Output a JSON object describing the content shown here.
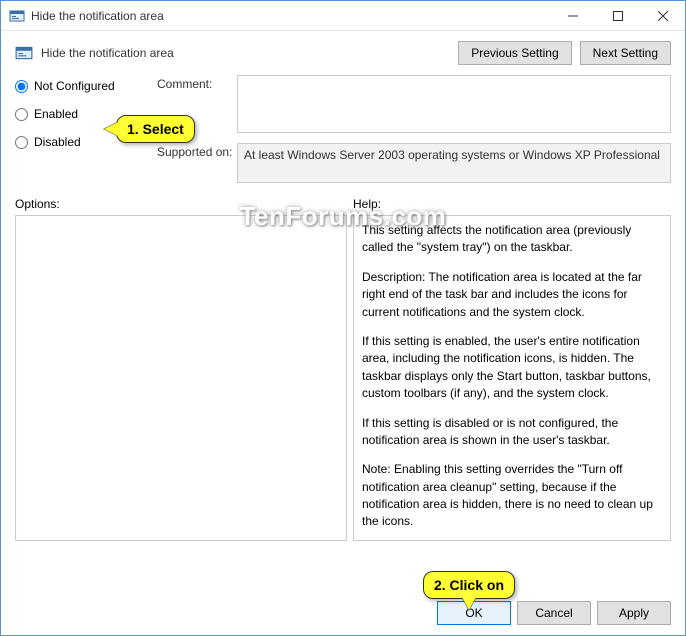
{
  "titlebar": {
    "title": "Hide the notification area"
  },
  "header": {
    "setting_title": "Hide the notification area",
    "prev": "Previous Setting",
    "next": "Next Setting"
  },
  "radios": {
    "not_configured": "Not Configured",
    "enabled": "Enabled",
    "disabled": "Disabled"
  },
  "fields": {
    "comment_label": "Comment:",
    "comment_value": "",
    "supported_label": "Supported on:",
    "supported_value": "At least Windows Server 2003 operating systems or Windows XP Professional"
  },
  "labels": {
    "options": "Options:",
    "help": "Help:"
  },
  "help": {
    "p1": "This setting affects the notification area (previously called the \"system tray\") on the taskbar.",
    "p2": "Description: The notification area is located at the far right end of the task bar and includes the icons for current notifications and the system clock.",
    "p3": "If this setting is enabled, the user's entire notification area, including the notification icons, is hidden. The taskbar displays only the Start button, taskbar buttons, custom toolbars (if any), and the system clock.",
    "p4": "If this setting is disabled or is not configured, the notification area is shown in the user's taskbar.",
    "p5": "Note: Enabling this setting overrides the \"Turn off notification area cleanup\" setting, because if the notification area is hidden, there is no need to clean up the icons."
  },
  "buttons": {
    "ok": "OK",
    "cancel": "Cancel",
    "apply": "Apply"
  },
  "annotations": {
    "step1": "1. Select",
    "step2": "2. Click on"
  },
  "watermark": "TenForums.com"
}
